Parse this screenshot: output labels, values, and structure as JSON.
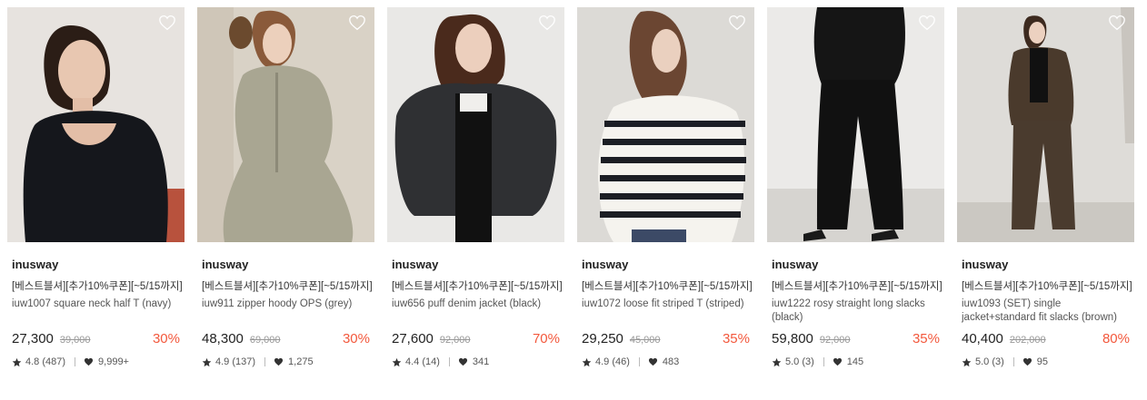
{
  "products": [
    {
      "brand": "inusway",
      "promo": "[베스트블셔][추가10%쿠폰][~5/15까지]",
      "name": "iuw1007 square neck half T (navy)",
      "price": "27,300",
      "original_price": "39,000",
      "discount": "30%",
      "rating": "4.8 (487)",
      "likes": "9,999+",
      "image_icon": "model-black-top-photo"
    },
    {
      "brand": "inusway",
      "promo": "[베스트블셔][추가10%쿠폰][~5/15까지]",
      "name": "iuw911 zipper hoody OPS (grey)",
      "price": "48,300",
      "original_price": "69,000",
      "discount": "30%",
      "rating": "4.9 (137)",
      "likes": "1,275",
      "image_icon": "model-grey-hoody-photo"
    },
    {
      "brand": "inusway",
      "promo": "[베스트블셔][추가10%쿠폰][~5/15까지]",
      "name": "iuw656 puff denim jacket (black)",
      "price": "27,600",
      "original_price": "92,000",
      "discount": "70%",
      "rating": "4.4 (14)",
      "likes": "341",
      "image_icon": "model-denim-jacket-photo"
    },
    {
      "brand": "inusway",
      "promo": "[베스트블셔][추가10%쿠폰][~5/15까지]",
      "name": "iuw1072 loose fit striped T (striped)",
      "price": "29,250",
      "original_price": "45,000",
      "discount": "35%",
      "rating": "4.9 (46)",
      "likes": "483",
      "image_icon": "model-striped-tee-photo"
    },
    {
      "brand": "inusway",
      "promo": "[베스트블셔][추가10%쿠폰][~5/15까지]",
      "name": "iuw1222 rosy straight long slacks (black)",
      "price": "59,800",
      "original_price": "92,000",
      "discount": "35%",
      "rating": "5.0 (3)",
      "likes": "145",
      "image_icon": "model-black-slacks-photo"
    },
    {
      "brand": "inusway",
      "promo": "[베스트블셔][추가10%쿠폰][~5/15까지]",
      "name": "iuw1093 (SET) single jacket+standard fit slacks (brown)",
      "price": "40,400",
      "original_price": "202,000",
      "discount": "80%",
      "rating": "5.0 (3)",
      "likes": "95",
      "image_icon": "model-brown-suit-photo"
    }
  ],
  "colors": {
    "discount": "#f3583c",
    "price": "#222222",
    "original_price": "#999999"
  }
}
